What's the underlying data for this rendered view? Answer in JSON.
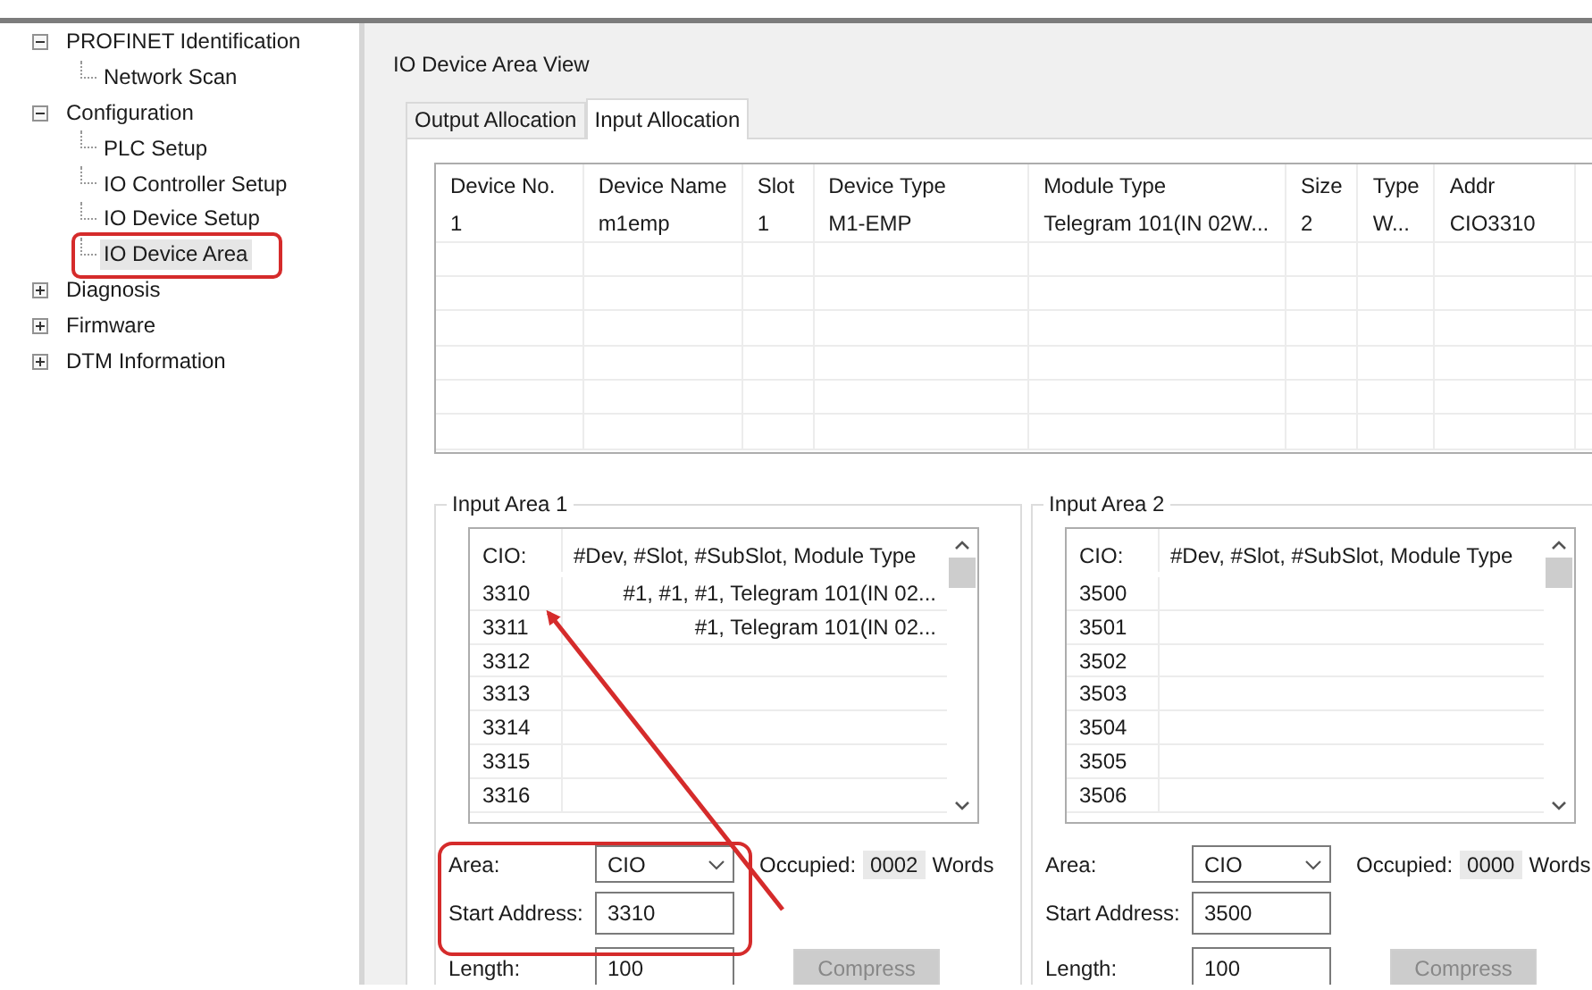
{
  "tree": [
    {
      "label": "PROFINET Identification",
      "expanded": true,
      "selected": false,
      "children": [
        {
          "label": "Network Scan",
          "selected": false
        }
      ]
    },
    {
      "label": "Configuration",
      "expanded": true,
      "selected": false,
      "children": [
        {
          "label": "PLC Setup",
          "selected": false
        },
        {
          "label": "IO Controller Setup",
          "selected": false
        },
        {
          "label": "IO Device Setup",
          "selected": false
        },
        {
          "label": "IO Device Area",
          "selected": true
        }
      ]
    },
    {
      "label": "Diagnosis",
      "expanded": false,
      "selected": false
    },
    {
      "label": "Firmware",
      "expanded": false,
      "selected": false
    },
    {
      "label": "DTM Information",
      "expanded": false,
      "selected": false
    }
  ],
  "view_title": "IO Device Area View",
  "tabs": [
    {
      "label": "Output Allocation",
      "selected": false
    },
    {
      "label": "Input Allocation",
      "selected": true
    }
  ],
  "device_table": {
    "columns": [
      "Device No.",
      "Device Name",
      "Slot",
      "Device Type",
      "Module Type",
      "Size",
      "Type",
      "Addr"
    ],
    "rows": [
      [
        "1",
        "m1emp",
        "1",
        "M1-EMP",
        "Telegram 101(IN 02W...",
        "2",
        "W...",
        "CIO3310"
      ]
    ]
  },
  "input_areas": [
    {
      "title": "Input Area 1",
      "list_columns": [
        "CIO:",
        "#Dev, #Slot, #SubSlot, Module Type"
      ],
      "list_rows": [
        {
          "address": "3310",
          "entry": "#1,  #1,  #1,  Telegram 101(IN 02..."
        },
        {
          "address": "3311",
          "entry": "#1,  Telegram 101(IN 02..."
        },
        {
          "address": "3312"
        },
        {
          "address": "3313"
        },
        {
          "address": "3314"
        },
        {
          "address": "3315"
        },
        {
          "address": "3316"
        }
      ],
      "area_label": "Area:",
      "area_value": "CIO",
      "occupied_label": "Occupied:",
      "occupied_value": "0002",
      "words_label": "Words",
      "start_label": "Start Address:",
      "start_value": "3310",
      "length_label": "Length:",
      "length_value": "100",
      "compress": {
        "label": "Compress",
        "disabled": true
      }
    },
    {
      "title": "Input Area 2",
      "list_columns": [
        "CIO:",
        "#Dev, #Slot, #SubSlot, Module Type"
      ],
      "list_rows": [
        {
          "address": "3500"
        },
        {
          "address": "3501"
        },
        {
          "address": "3502"
        },
        {
          "address": "3503"
        },
        {
          "address": "3504"
        },
        {
          "address": "3505"
        },
        {
          "address": "3506"
        }
      ],
      "area_label": "Area:",
      "area_value": "CIO",
      "occupied_label": "Occupied:",
      "occupied_value": "0000",
      "words_label": "Words",
      "start_label": "Start Address:",
      "start_value": "3500",
      "length_label": "Length:",
      "length_value": "100",
      "compress": {
        "label": "Compress",
        "disabled": true
      }
    }
  ]
}
